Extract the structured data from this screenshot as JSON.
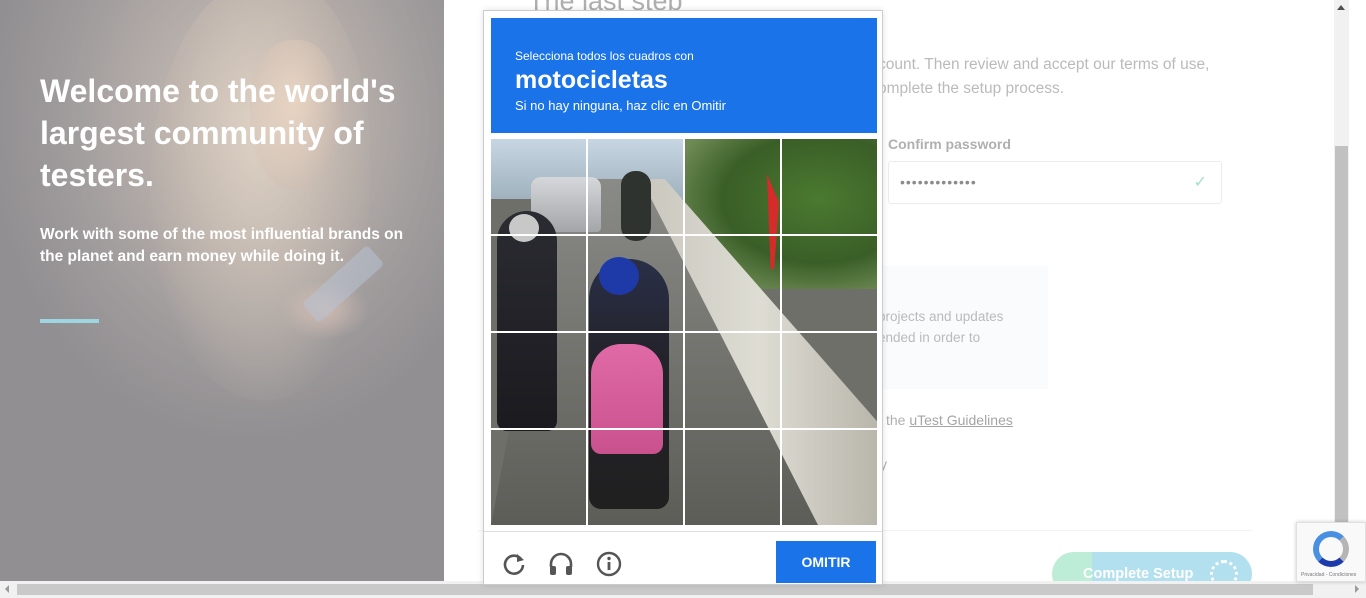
{
  "hero": {
    "title": "Welcome to the world's largest community of testers.",
    "subtitle": "Work with some of the most influential brands on the planet and earn money while doing it."
  },
  "form": {
    "heading": "The last step",
    "intro": "count. Then review and accept our terms of use, omplete the setup process.",
    "confirm_password_label": "Confirm password",
    "confirm_password_value": "•••••••••••••",
    "info_text": "projects and updates ended in order to",
    "guidelines_prefix": "the",
    "guidelines_link": "uTest Guidelines",
    "fragment": "y",
    "complete_button": "Complete Setup"
  },
  "captcha": {
    "intro": "Selecciona todos los cuadros con",
    "target": "motocicletas",
    "hint": "Si no hay ninguna, haz clic en Omitir",
    "skip_button": "OMITIR",
    "icons": [
      "reload-icon",
      "headphones-icon",
      "info-icon"
    ]
  },
  "badge": {
    "text": "Privacidad - Condiciones"
  },
  "colors": {
    "captcha_blue": "#1a73e8",
    "accent_teal": "#6fc3d3",
    "button_green": "#9ee4c5"
  }
}
